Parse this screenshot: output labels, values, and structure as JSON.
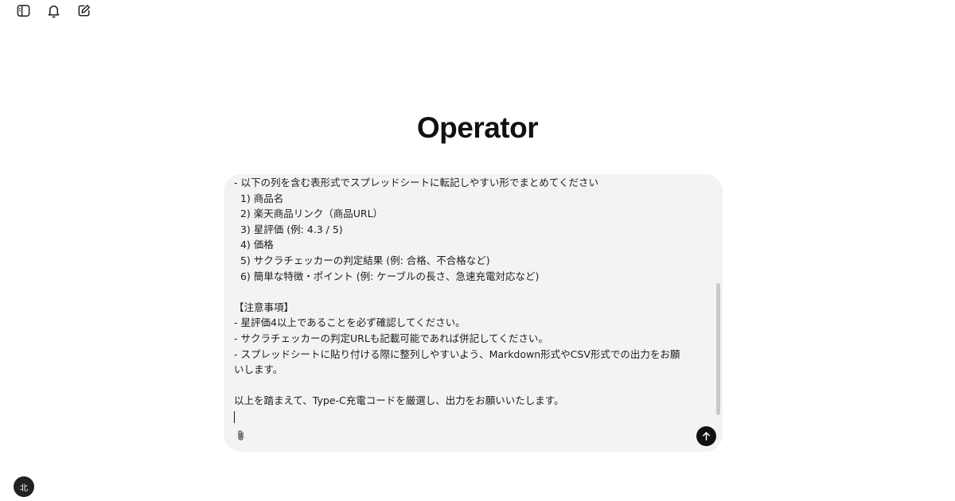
{
  "header": {
    "icons": [
      "sidebar-toggle-icon",
      "bell-icon",
      "edit-icon"
    ]
  },
  "main": {
    "title": "Operator"
  },
  "composer": {
    "lines": [
      "- 以下の列を含む表形式でスプレッドシートに転記しやすい形でまとめてください",
      "  1) 商品名",
      "  2) 楽天商品リンク（商品URL）",
      "  3) 星評価 (例: 4.3 / 5)",
      "  4) 価格",
      "  5) サクラチェッカーの判定結果 (例: 合格、不合格など)",
      "  6) 簡単な特徴・ポイント (例: ケーブルの長さ、急速充電対応など)",
      "",
      "【注意事項】",
      "- 星評価4以上であることを必ず確認してください。",
      "- サクラチェッカーの判定URLも記載可能であれば併記してください。",
      "- スプレッドシートに貼り付ける際に整列しやすいよう、Markdown形式やCSV形式での出力をお願",
      "いします。",
      "",
      "以上を踏まえて、Type-C充電コードを厳選し、出力をお願いいたします。"
    ],
    "attach_icon": "paperclip-icon",
    "send_icon": "arrow-up-icon"
  },
  "user": {
    "avatar_text": "北"
  }
}
